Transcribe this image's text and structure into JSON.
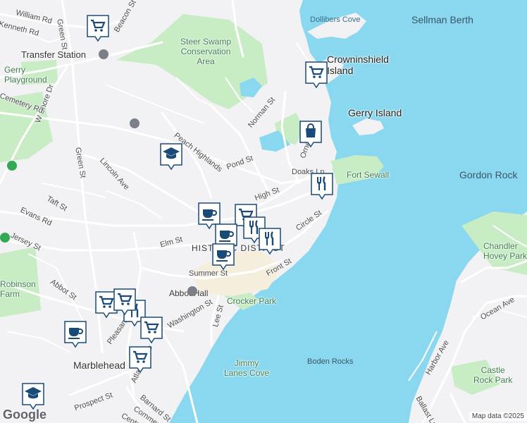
{
  "labels": {
    "water": [
      "Sellman Berth",
      "Dollibers Cove",
      "Gordon Rock",
      "Boden Rocks"
    ],
    "islands": [
      "Crowninshield\nIsland",
      "Gerry Island"
    ],
    "parks": [
      "Steer Swamp\nConservation\nArea",
      "Gerry\nPlayground",
      "Fort Sewall",
      "Crocker Park",
      "Jimmy\nLanes Cove",
      "Robinson\nFarm",
      "Chandler\nHovey Park",
      "Castle\nRock Park"
    ],
    "places": [
      "Transfer Station",
      "Marblehead",
      "HISTORIC DISTRICT",
      "Abbot Hall"
    ],
    "streets": [
      "William Rd",
      "Kenneth Rd",
      "Green St",
      "Beacon St",
      "W Shore Dr",
      "Cemetery Rd",
      "Norman St",
      "Peach Highlands",
      "Pond St",
      "Orne St",
      "Doaks Ln",
      "High St",
      "Lincoln Ave",
      "Taft St",
      "Evans Rd",
      "Green St",
      "Jersey St",
      "Elm St",
      "Circle St",
      "Front St",
      "Summer St",
      "Abbot St",
      "Pleasant St",
      "Washington St",
      "Lee St",
      "Harbor Ave",
      "Ocean Ave",
      "Ballast Ln",
      "Prospect St",
      "Atlantic Ave",
      "Barnard St",
      "Commercial St",
      "Central St"
    ]
  },
  "markers": [
    {
      "icon": "shopping-cart-icon"
    },
    {
      "icon": "shopping-cart-icon"
    },
    {
      "icon": "shopping-bag-icon"
    },
    {
      "icon": "school-icon"
    },
    {
      "icon": "restaurant-icon"
    },
    {
      "icon": "cafe-icon"
    },
    {
      "icon": "shopping-cart-icon"
    },
    {
      "icon": "restaurant-icon"
    },
    {
      "icon": "restaurant-icon"
    },
    {
      "icon": "cafe-icon"
    },
    {
      "icon": "cafe-icon"
    },
    {
      "icon": "shopping-cart-icon"
    },
    {
      "icon": "restaurant-icon"
    },
    {
      "icon": "shopping-cart-icon"
    },
    {
      "icon": "cafe-icon"
    },
    {
      "icon": "shopping-cart-icon"
    },
    {
      "icon": "shopping-cart-icon"
    },
    {
      "icon": "school-icon"
    }
  ],
  "branding": {
    "logo": "Google",
    "attribution": "Map data ©2025"
  },
  "colors": {
    "water": "#8ad8ef",
    "park": "#c8ecc4",
    "land": "#f2f1f4",
    "pin": "#1a4a78",
    "road": "#ffffff"
  }
}
